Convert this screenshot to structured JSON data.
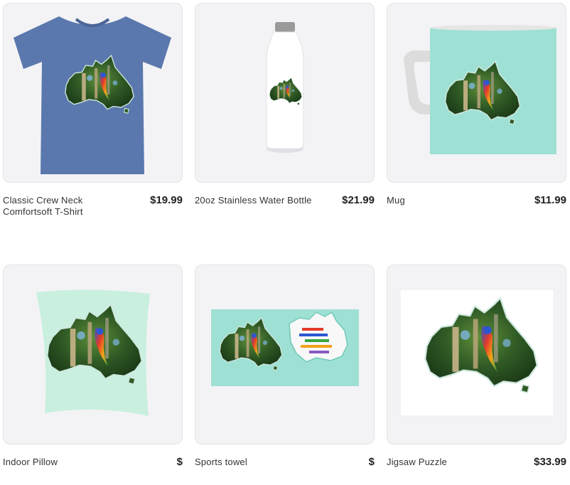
{
  "products": [
    {
      "name": "Classic Crew Neck Comfortsoft T-Shirt",
      "price": "$19.99",
      "icon": "t-shirt",
      "color": "#5a78ad"
    },
    {
      "name": "20oz Stainless Water Bottle",
      "price": "$21.99",
      "icon": "water-bottle",
      "color": "#ffffff"
    },
    {
      "name": "Mug",
      "price": "$11.99",
      "icon": "mug",
      "color": "#9fe0d4"
    },
    {
      "name": "Indoor Pillow",
      "price": "$",
      "icon": "pillow",
      "color": "#c9efdf"
    },
    {
      "name": "Sports towel",
      "price": "$",
      "icon": "towel",
      "color": "#9fe0d4"
    },
    {
      "name": "Jigsaw Puzzle",
      "price": "$33.99",
      "icon": "puzzle",
      "color": "#ffffff"
    }
  ]
}
